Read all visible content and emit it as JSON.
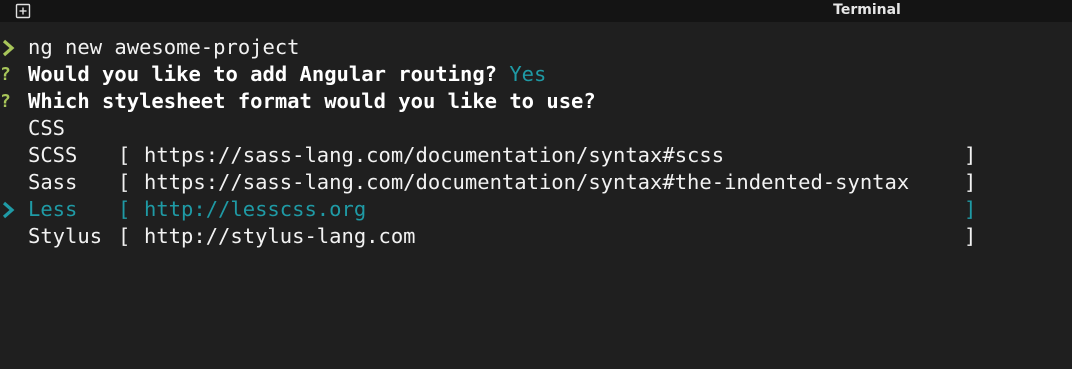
{
  "window": {
    "title": "Terminal"
  },
  "terminal": {
    "command": "ng new awesome-project",
    "routing_question": "Would you like to add Angular routing?",
    "routing_answer": "Yes",
    "stylesheet_question": "Which stylesheet format would you like to use?",
    "options": [
      {
        "name": "CSS",
        "url": "",
        "selected": false
      },
      {
        "name": "SCSS",
        "url": "https://sass-lang.com/documentation/syntax#scss",
        "selected": false
      },
      {
        "name": "Sass",
        "url": "https://sass-lang.com/documentation/syntax#the-indented-syntax",
        "selected": false
      },
      {
        "name": "Less",
        "url": "http://lesscss.org",
        "selected": true
      },
      {
        "name": "Stylus",
        "url": "http://stylus-lang.com",
        "selected": false
      }
    ],
    "open_bracket": "[",
    "close_bracket": "]",
    "prompt_glyph": "❯",
    "question_glyph": "?"
  },
  "colors": {
    "background": "#1f1f1f",
    "titlebar": "#141414",
    "text": "#f2f2f2",
    "accent_green": "#a8c65a",
    "accent_teal": "#1f9aa5"
  },
  "icons": {
    "new_tab": "new-tab-icon",
    "prompt": "chevron-right-icon",
    "selection": "chevron-right-icon"
  }
}
